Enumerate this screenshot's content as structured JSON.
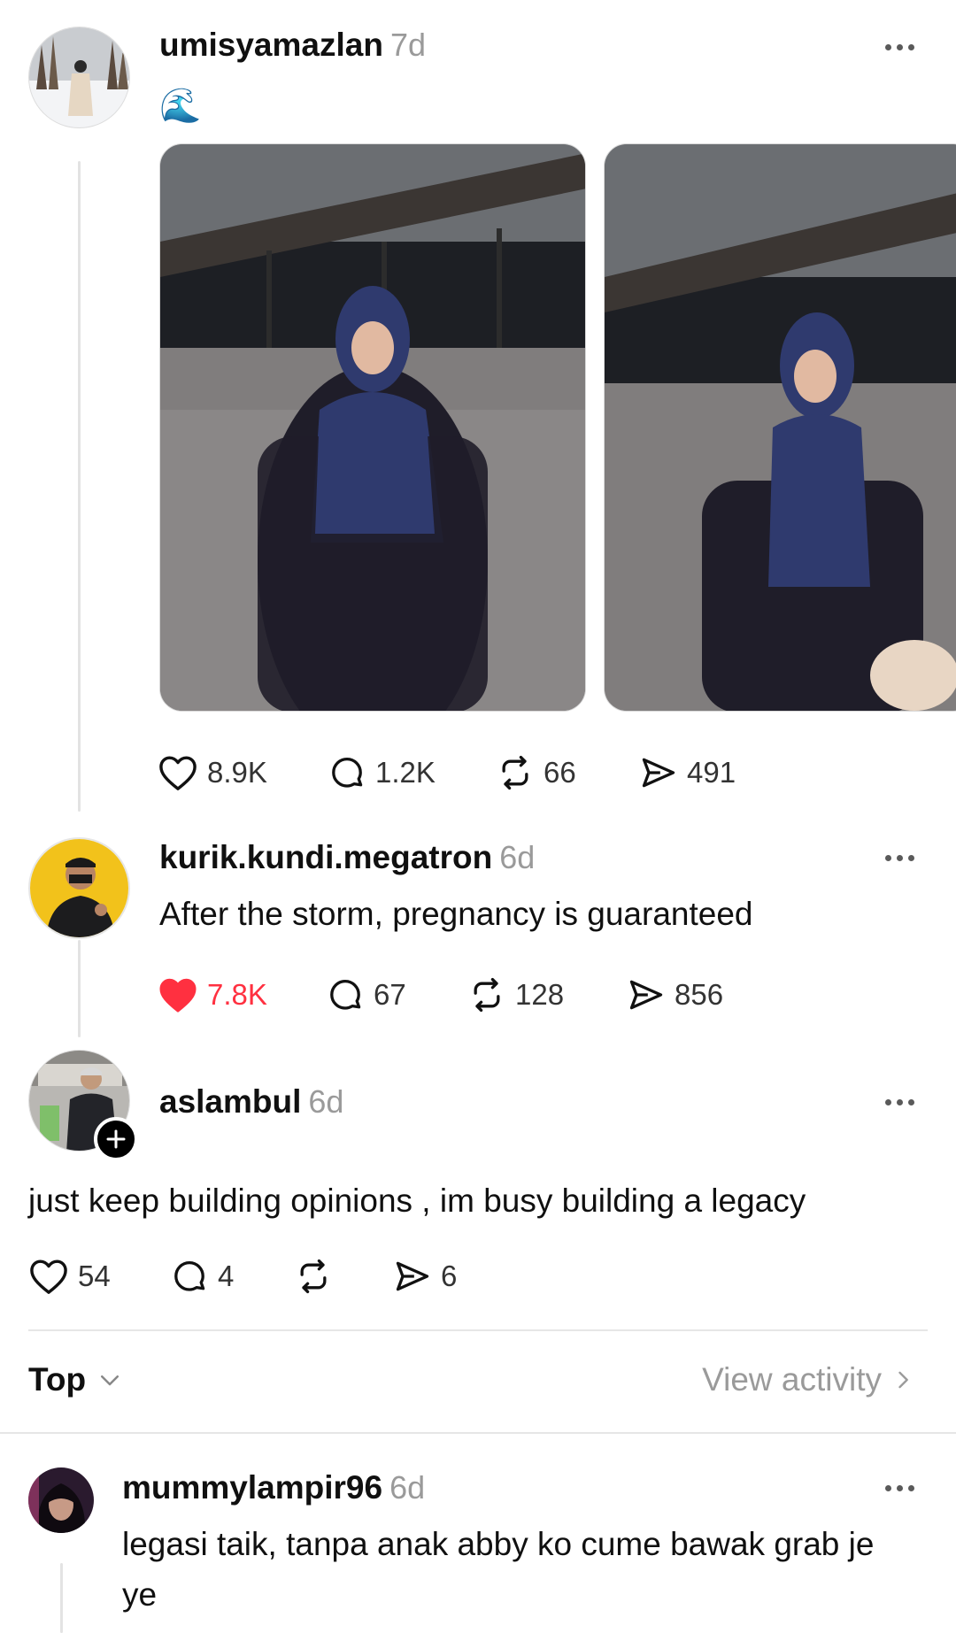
{
  "posts": [
    {
      "username": "umisyamazlan",
      "time": "7d",
      "text": "🌊",
      "likes": "8.9K",
      "replies": "1.2K",
      "reposts": "66",
      "shares": "491"
    },
    {
      "username": "kurik.kundi.megatron",
      "time": "6d",
      "text": "After the storm, pregnancy is guaranteed",
      "likes": "7.8K",
      "liked": true,
      "replies": "67",
      "reposts": "128",
      "shares": "856"
    },
    {
      "username": "aslambul",
      "time": "6d",
      "text": "just keep building opinions , im busy building a legacy",
      "likes": "54",
      "replies": "4",
      "reposts": "",
      "shares": "6"
    }
  ],
  "sort": {
    "label": "Top",
    "activity_link": "View activity"
  },
  "reply": {
    "username": "mummylampir96",
    "time": "6d",
    "text_line1": "legasi taik, tanpa anak abby ko cume bawak grab je",
    "text_line2": "ye"
  },
  "colors": {
    "like_active": "#ff3040",
    "text_primary": "#101010",
    "text_secondary": "#9a9a9a"
  }
}
